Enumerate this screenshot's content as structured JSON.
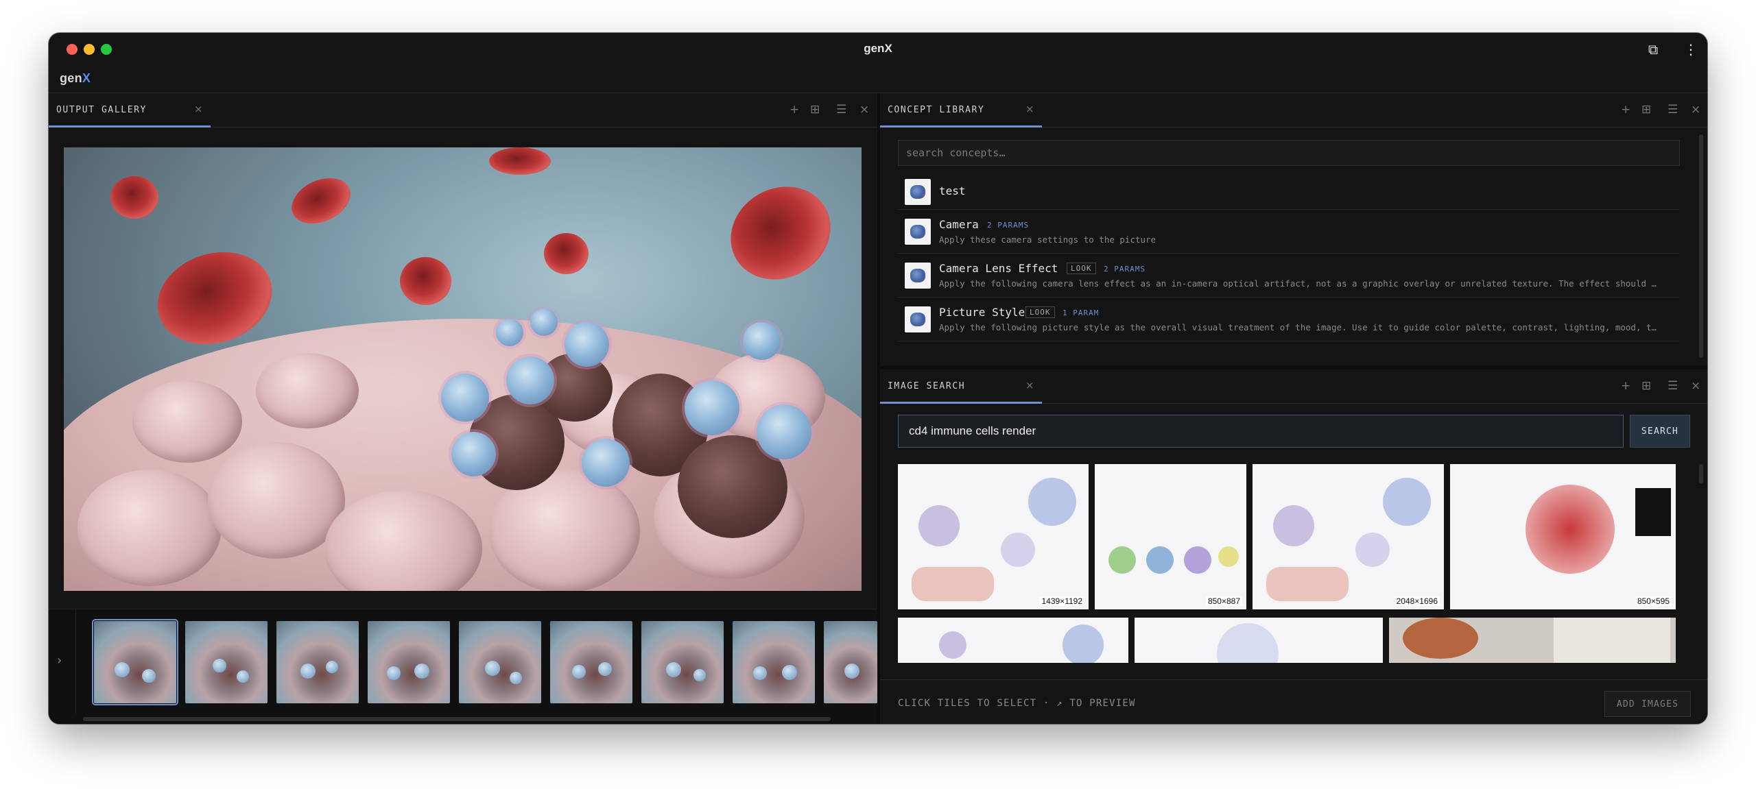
{
  "window": {
    "title": "genX",
    "brand_prefix": "gen",
    "brand_suffix": "X"
  },
  "output_gallery": {
    "tab_label": "OUTPUT GALLERY",
    "tab_close": "×",
    "actions": [
      "+",
      "⊞",
      "☰",
      "×"
    ],
    "strip_toggle": "›",
    "thumbnail_count": 9,
    "selected_thumbnail": 0
  },
  "concept_library": {
    "tab_label": "CONCEPT LIBRARY",
    "tab_close": "×",
    "actions": [
      "+",
      "⊞",
      "☰",
      "×"
    ],
    "search_placeholder": "search concepts…",
    "items": [
      {
        "name": "test",
        "badges": [],
        "params": "",
        "description": ""
      },
      {
        "name": "Camera",
        "badges": [],
        "params": "2 PARAMS",
        "description": "Apply these camera settings to the picture"
      },
      {
        "name": "Camera Lens Effect",
        "badges": [
          "LOOK"
        ],
        "params": "2 PARAMS",
        "description": "Apply the following camera lens effect as an in-camera optical artifact, not as a graphic overlay or unrelated texture. The effect should …"
      },
      {
        "name": "Picture Style",
        "badges": [
          "LOOK"
        ],
        "params": "1 PARAM",
        "description": "Apply the following picture style as the overall visual treatment of the image. Use it to guide color palette, contrast, lighting, mood, t…"
      }
    ]
  },
  "image_search": {
    "tab_label": "IMAGE SEARCH",
    "tab_close": "×",
    "actions": [
      "+",
      "⊞",
      "☰",
      "×"
    ],
    "query": "cd4 immune cells render",
    "search_button": "SEARCH",
    "results": [
      {
        "dims": "1439×1192"
      },
      {
        "dims": "850×887"
      },
      {
        "dims": "2048×1696"
      },
      {
        "dims": "850×595"
      },
      {
        "dims": ""
      },
      {
        "dims": ""
      },
      {
        "dims": ""
      }
    ],
    "footer_hint": "CLICK TILES TO SELECT · ↗ TO PREVIEW",
    "add_button": "ADD IMAGES"
  },
  "colors": {
    "accent": "#6f8fd0",
    "background": "#141414",
    "brand_x": "#5b8def"
  }
}
